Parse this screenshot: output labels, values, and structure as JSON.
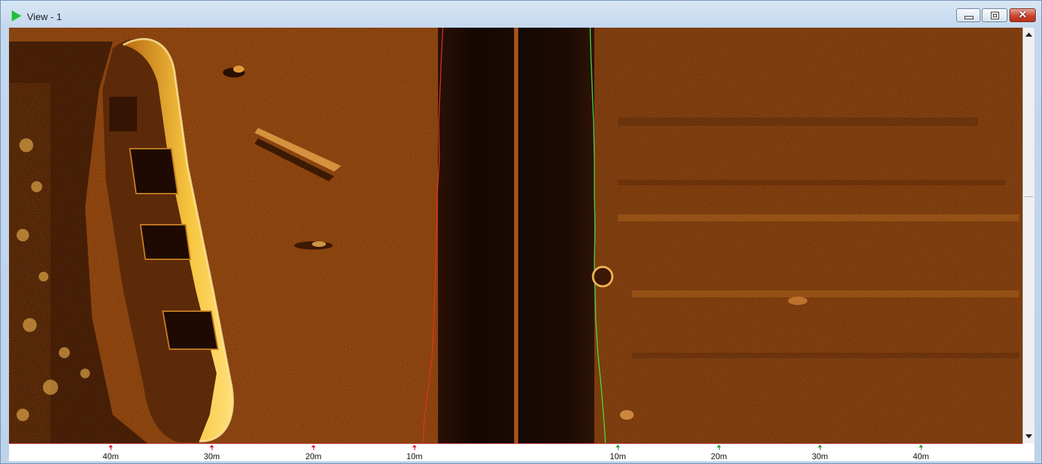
{
  "window": {
    "title": "View - 1",
    "close_glyph": "✕",
    "icon": "play-triangle-icon"
  },
  "colors": {
    "port_track": "#e0312b",
    "starboard_track": "#42e34a",
    "sonar_dark": "#1c0b02",
    "sonar_mid": "#8a4210",
    "sonar_bright": "#ffd15a"
  },
  "ruler": {
    "port_ticks": [
      "40m",
      "30m",
      "20m",
      "10m"
    ],
    "starboard_ticks": [
      "10m",
      "20m",
      "30m",
      "40m"
    ]
  }
}
